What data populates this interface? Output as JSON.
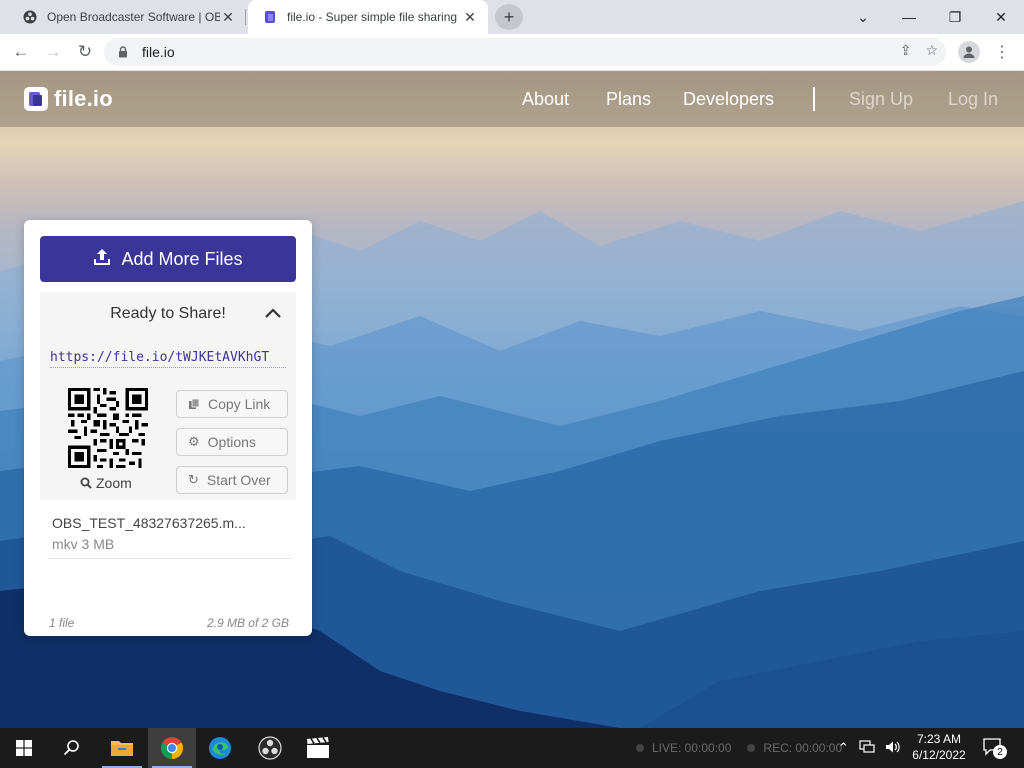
{
  "browser": {
    "tabs": [
      {
        "title": "Open Broadcaster Software | OBS",
        "icon": "obs-icon",
        "active": false
      },
      {
        "title": "file.io - Super simple file sharing",
        "icon": "fileio-icon",
        "active": true
      }
    ],
    "address": "file.io"
  },
  "site": {
    "brand": "file.io",
    "nav": {
      "about": "About",
      "plans": "Plans",
      "developers": "Developers",
      "signup": "Sign Up",
      "login": "Log In"
    }
  },
  "upload": {
    "add_button": "Add More Files",
    "status": "Ready to Share!",
    "share_link": "https://file.io/tWJKEtAVKhGT",
    "zoom_label": "Zoom",
    "actions": {
      "copy": "Copy Link",
      "options": "Options",
      "start_over": "Start Over"
    },
    "file": {
      "name": "OBS_TEST_48327637265.m...",
      "meta": "mkv 3 MB"
    },
    "footer": {
      "count": "1 file",
      "usage": "2.9 MB of 2 GB"
    }
  },
  "taskbar": {
    "apps": [
      "file-explorer-icon",
      "chrome-icon",
      "edge-icon",
      "obs-icon",
      "clapperboard-icon"
    ],
    "obs_status": {
      "live": "LIVE: 00:00:00",
      "rec": "REC: 00:00:00"
    },
    "clock": {
      "time": "7:23 AM",
      "date": "6/12/2022"
    },
    "notifications": "2"
  },
  "colors": {
    "accent": "#3b3597",
    "tab_strip": "#dee1e6",
    "taskbar": "#1b1b1b"
  }
}
